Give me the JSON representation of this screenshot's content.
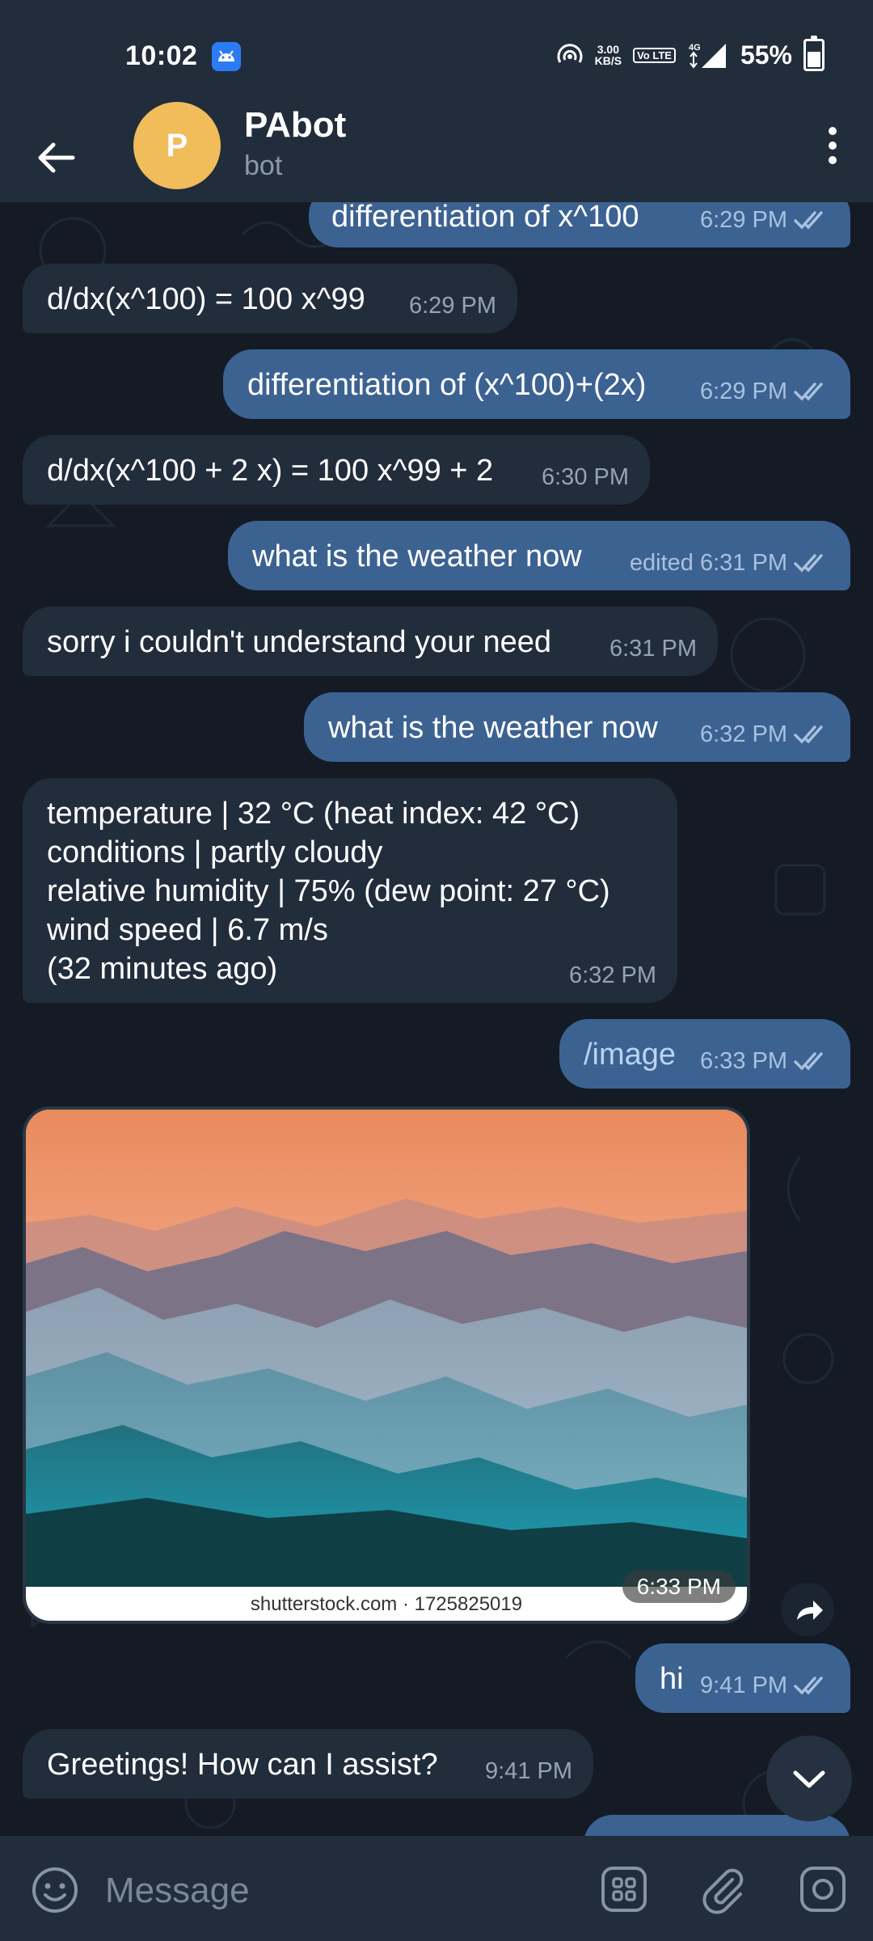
{
  "status_bar": {
    "time": "10:02",
    "net_speed": "3.00",
    "net_unit": "KB/S",
    "volte": "Vo LTE",
    "network": "4G",
    "battery": "55%"
  },
  "header": {
    "avatar_letter": "P",
    "title": "PAbot",
    "subtitle": "bot"
  },
  "messages": [
    {
      "dir": "out",
      "text": "differentiation of x^100",
      "time": "6:29 PM"
    },
    {
      "dir": "in",
      "text": "d/dx(x^100) = 100 x^99",
      "time": "6:29 PM"
    },
    {
      "dir": "out",
      "text": "differentiation of (x^100)+(2x)",
      "time": "6:29 PM"
    },
    {
      "dir": "in",
      "text": "d/dx(x^100 + 2 x) = 100 x^99 + 2",
      "time": "6:30 PM"
    },
    {
      "dir": "out",
      "text": "what is the weather now",
      "time": "edited 6:31 PM"
    },
    {
      "dir": "in",
      "text": "sorry i couldn't understand your need",
      "time": "6:31 PM"
    },
    {
      "dir": "out",
      "text": "what is the weather now",
      "time": "6:32 PM"
    },
    {
      "dir": "in",
      "text": "temperature | 32 °C (heat index: 42 °C)\nconditions | partly cloudy\nrelative humidity | 75% (dew point: 27 °C)\nwind speed | 6.7 m/s\n(32 minutes ago)",
      "time": "6:32 PM"
    },
    {
      "dir": "out",
      "text": "/image",
      "time": "6:33 PM"
    },
    {
      "dir": "out",
      "text": "hi",
      "time": "9:41 PM"
    },
    {
      "dir": "in",
      "text": "Greetings! How can I assist?",
      "time": "9:41 PM"
    }
  ],
  "image_message": {
    "caption": "shutterstock.com · 1725825019",
    "time": "6:33 PM"
  },
  "composer": {
    "placeholder": "Message"
  },
  "colors": {
    "background": "#141b24",
    "bar": "#212d3b",
    "incoming": "#212d3b",
    "outgoing": "#3c6292",
    "avatar": "#f0bd5a"
  }
}
